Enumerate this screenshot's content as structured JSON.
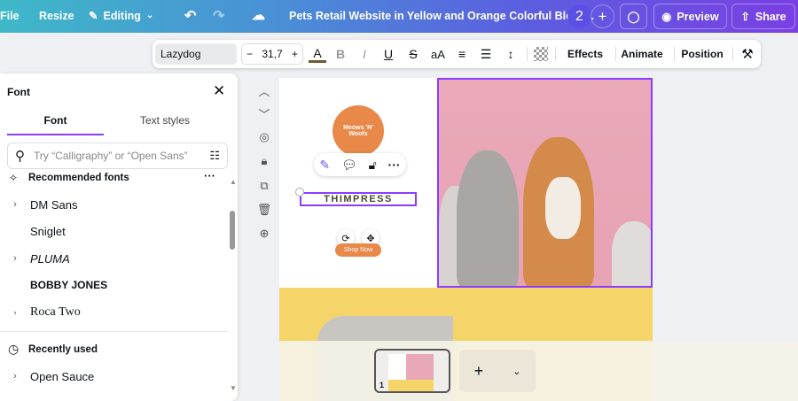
{
  "topbar": {
    "file": "File",
    "resize": "Resize",
    "editing": "Editing",
    "title": "Pets Retail Website in Yellow and Orange Colorful Block...",
    "collaborators": "2",
    "preview": "Preview",
    "share": "Share"
  },
  "toolbar": {
    "font": "Lazydog",
    "font_size": "31,7",
    "minus": "−",
    "plus": "+",
    "effects": "Effects",
    "animate": "Animate",
    "position": "Position",
    "case": "aA"
  },
  "panel": {
    "title": "Font",
    "tabs": [
      {
        "label": "Font"
      },
      {
        "label": "Text styles"
      }
    ],
    "search_placeholder": "Try “Calligraphy” or “Open Sans”",
    "recommended_heading": "Recommended fonts",
    "recommended": [
      {
        "label": "DM Sans",
        "expandable": true
      },
      {
        "label": "Sniglet",
        "expandable": false
      },
      {
        "label": "PLUMA",
        "expandable": true
      },
      {
        "label": "BOBBY JONES",
        "expandable": false
      },
      {
        "label": "Roca Two",
        "expandable": true
      }
    ],
    "recent_heading": "Recently used",
    "recent": [
      {
        "label": "Open Sauce",
        "expandable": true
      }
    ]
  },
  "canvas": {
    "logo_text": "Meows 'N' Woofs",
    "selected_text": "THIMPRESS",
    "button_label": "Shop Now"
  },
  "pages": {
    "current_page": "1"
  },
  "colors": {
    "accent": "#8b3dff",
    "orange": "#e8894a",
    "yellow": "#f5d56a",
    "pink": "#eaa9b8"
  }
}
